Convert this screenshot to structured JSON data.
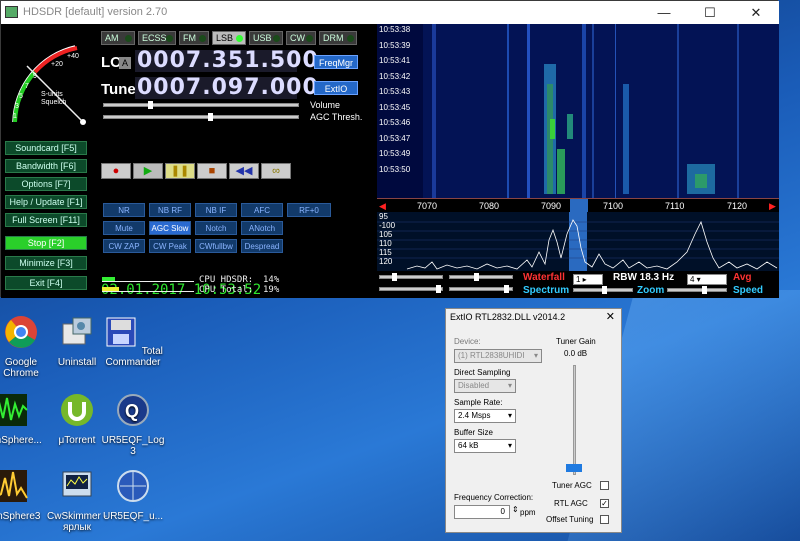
{
  "hdsdr": {
    "title": "HDSDR [default]  version 2.70",
    "window_controls": {
      "minimize": "—",
      "maximize": "☐",
      "close": "✕"
    },
    "modes": [
      {
        "label": "AM",
        "active": false
      },
      {
        "label": "ECSS",
        "active": false
      },
      {
        "label": "FM",
        "active": false
      },
      {
        "label": "LSB",
        "active": true
      },
      {
        "label": "USB",
        "active": false
      },
      {
        "label": "CW",
        "active": false
      },
      {
        "label": "DRM",
        "active": false
      }
    ],
    "lo_label": "LO",
    "lo_value": "0007.351.500",
    "tune_label": "Tune",
    "tune_value": "0007.097.000",
    "freqmgr_label": "FreqMgr",
    "extio_label": "ExtIO",
    "volume_label": "Volume",
    "agc_thresh_label": "AGC Thresh.",
    "squelch_label": "S-units\nSquelch",
    "meter_scale": [
      "+40",
      "+20",
      "9",
      "7",
      "5",
      "3",
      "1"
    ],
    "side_buttons": [
      {
        "label": "Soundcard  [F5]",
        "style": "normal"
      },
      {
        "label": "Bandwidth  [F6]",
        "style": "normal"
      },
      {
        "label": "Options   [F7]",
        "style": "normal"
      },
      {
        "label": "Help / Update  [F1]",
        "style": "normal"
      },
      {
        "label": "Full Screen  [F11]",
        "style": "normal"
      },
      {
        "label": "Stop       [F2]",
        "style": "green"
      },
      {
        "label": "Minimize    [F3]",
        "style": "normal"
      },
      {
        "label": "Exit       [F4]",
        "style": "normal"
      }
    ],
    "dsp_row1": [
      {
        "label": "NR",
        "on": false
      },
      {
        "label": "NB RF",
        "on": false
      },
      {
        "label": "NB IF",
        "on": false
      },
      {
        "label": "AFC",
        "on": false
      },
      {
        "label": "RF+0",
        "on": false
      }
    ],
    "dsp_row2": [
      {
        "label": "Mute",
        "on": false
      },
      {
        "label": "AGC Slow",
        "on": true
      },
      {
        "label": "Notch",
        "on": false
      },
      {
        "label": "ANotch",
        "on": false
      }
    ],
    "dsp_row3": [
      {
        "label": "CW ZAP",
        "on": false
      },
      {
        "label": "CW Peak",
        "on": false
      },
      {
        "label": "CWfullbw",
        "on": false
      },
      {
        "label": "Despread",
        "on": false
      }
    ],
    "datetime": "02.01.2017  10:53:52",
    "cpu_hdsdr_label": "CPU HDSDR:",
    "cpu_hdsdr_value": "14%",
    "cpu_total_label": "CPU Total:",
    "cpu_total_value": "19%",
    "cpu_hdsdr_pct": 14,
    "cpu_total_pct": 19,
    "waterfall_times": [
      "10:53:38",
      "10:53:39",
      "10:53:41",
      "10:53:42",
      "10:53:43",
      "10:53:45",
      "10:53:46",
      "10:53:47",
      "10:53:49",
      "10:53:50"
    ],
    "freq_scale": [
      "7070",
      "7080",
      "7090",
      "7100",
      "7110",
      "7120"
    ],
    "spectrum_db": [
      "95",
      "-100",
      "105",
      "110",
      "115",
      "120"
    ],
    "waterfall_label": "Waterfall",
    "spectrum_label": "Spectrum",
    "rbw_label": "RBW 18.3 Hz",
    "zoom_label": "Zoom",
    "avg_label": "Avg",
    "speed_label": "Speed",
    "avg_value": "4",
    "step_value": "1"
  },
  "desktop_icons": [
    {
      "label": "Google Chrome",
      "icon": "chrome-icon"
    },
    {
      "label": "Uninstall",
      "icon": "uninstall-icon"
    },
    {
      "label": "Total Commander",
      "icon": "total-commander-icon"
    },
    {
      "label": "HamSphere...",
      "icon": "hamsphere-icon"
    },
    {
      "label": "μTorrent",
      "icon": "utorrent-icon"
    },
    {
      "label": "UR5EQF_Log 3",
      "icon": "ur5eqf-log-icon"
    },
    {
      "label": "HamSphere3",
      "icon": "hamsphere3-icon"
    },
    {
      "label": "CwSkimmer - ярлык",
      "icon": "cwskimmer-icon"
    },
    {
      "label": "UR5EQF_u...",
      "icon": "ur5eqf-u-icon"
    }
  ],
  "extio": {
    "title": "ExtIO RTL2832.DLL v2014.2",
    "close": "✕",
    "device_label": "Device:",
    "device_value": "(1) RTL2838UHIDI",
    "direct_sampling_label": "Direct Sampling",
    "direct_sampling_value": "Disabled",
    "sample_rate_label": "Sample Rate:",
    "sample_rate_value": "2.4 Msps",
    "buffer_size_label": "Buffer Size",
    "buffer_size_value": "64 kB",
    "tuner_gain_label": "Tuner Gain",
    "tuner_gain_value": "0.0 dB",
    "freq_correction_label": "Frequency Correction:",
    "freq_correction_value": "0",
    "ppm_label": "ppm",
    "tuner_agc_label": "Tuner AGC",
    "tuner_agc_checked": false,
    "rtl_agc_label": "RTL AGC",
    "rtl_agc_checked": true,
    "offset_tuning_label": "Offset Tuning",
    "offset_tuning_checked": false
  }
}
